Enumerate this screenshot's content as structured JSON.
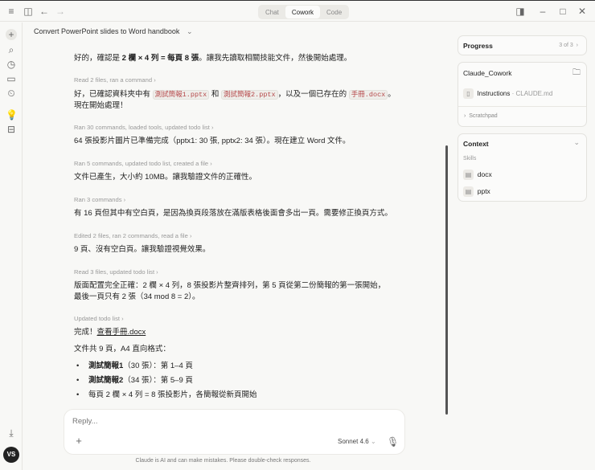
{
  "topbar": {
    "tabs": [
      "Chat",
      "Cowork",
      "Code"
    ],
    "active": "Cowork"
  },
  "conversation": {
    "title": "Convert PowerPoint slides to Word handbook"
  },
  "messages": {
    "m1": {
      "a": "好的，確認是 ",
      "b": "2 欄 × 4 列 = 每頁 8 張",
      "c": "。讓我先讀取相關技能文件，然後開始處理。"
    },
    "meta1": "Read 2 files, ran a command",
    "m2": {
      "a": "好，已確認資料夾中有 ",
      "f1": "測試簡報1.pptx",
      "b": " 和 ",
      "f2": "測試簡報2.pptx",
      "c": "，以及一個已存在的 ",
      "f3": "手冊.docx",
      "d": "。",
      "e": "現在開始處理！"
    },
    "meta2": "Ran 30 commands, loaded tools, updated todo list",
    "m3": "64 張投影片圖片已準備完成（pptx1: 30 張, pptx2: 34 張）。現在建立 Word 文件。",
    "meta3": "Ran 5 commands, updated todo list, created a file",
    "m4": "文件已產生，大小約 10MB。讓我驗證文件的正確性。",
    "meta4": "Ran 3 commands",
    "m5": "有 16 頁但其中有空白頁，是因為換頁段落放在滿版表格後面會多出一頁。需要修正換頁方式。",
    "meta5": "Edited 2 files, ran 2 commands, read a file",
    "m6": "9 頁、沒有空白頁。讓我驗證視覺效果。",
    "meta6": "Read 3 files, updated todo list",
    "m7": "版面配置完全正確：2 欄 × 4 列，8 張投影片整齊排列，第 5 頁從第二份簡報的第一張開始，最後一頁只有 2 張（34 mod 8 = 2）。",
    "meta7": "Updated todo list",
    "m8": {
      "a": "完成！",
      "link": "查看手冊.docx"
    },
    "m9": "文件共 9 頁，A4 直向格式：",
    "bullets": [
      {
        "b": "測試簡報1",
        "t": "（30 張）：第 1–4 頁"
      },
      {
        "b": "測試簡報2",
        "t": "（34 張）：第 5–9 頁"
      },
      {
        "b": "",
        "t": "每頁 2 欄 × 4 列 = 8 張投影片，各簡報從新頁開始"
      }
    ]
  },
  "composer": {
    "placeholder": "Reply...",
    "model": "Sonnet 4.6",
    "disclaimer": "Claude is AI and can make mistakes. Please double-check responses."
  },
  "user": {
    "initials": "VS"
  },
  "panel": {
    "progress": {
      "label": "Progress",
      "count": "3 of 3"
    },
    "folder": {
      "name": "Claude_Cowork",
      "file": "Instructions",
      "file_sub": "· CLAUDE.md",
      "scratchpad": "Scratchpad"
    },
    "context": {
      "label": "Context",
      "skills_label": "Skills",
      "skills": [
        "docx",
        "pptx"
      ]
    }
  }
}
